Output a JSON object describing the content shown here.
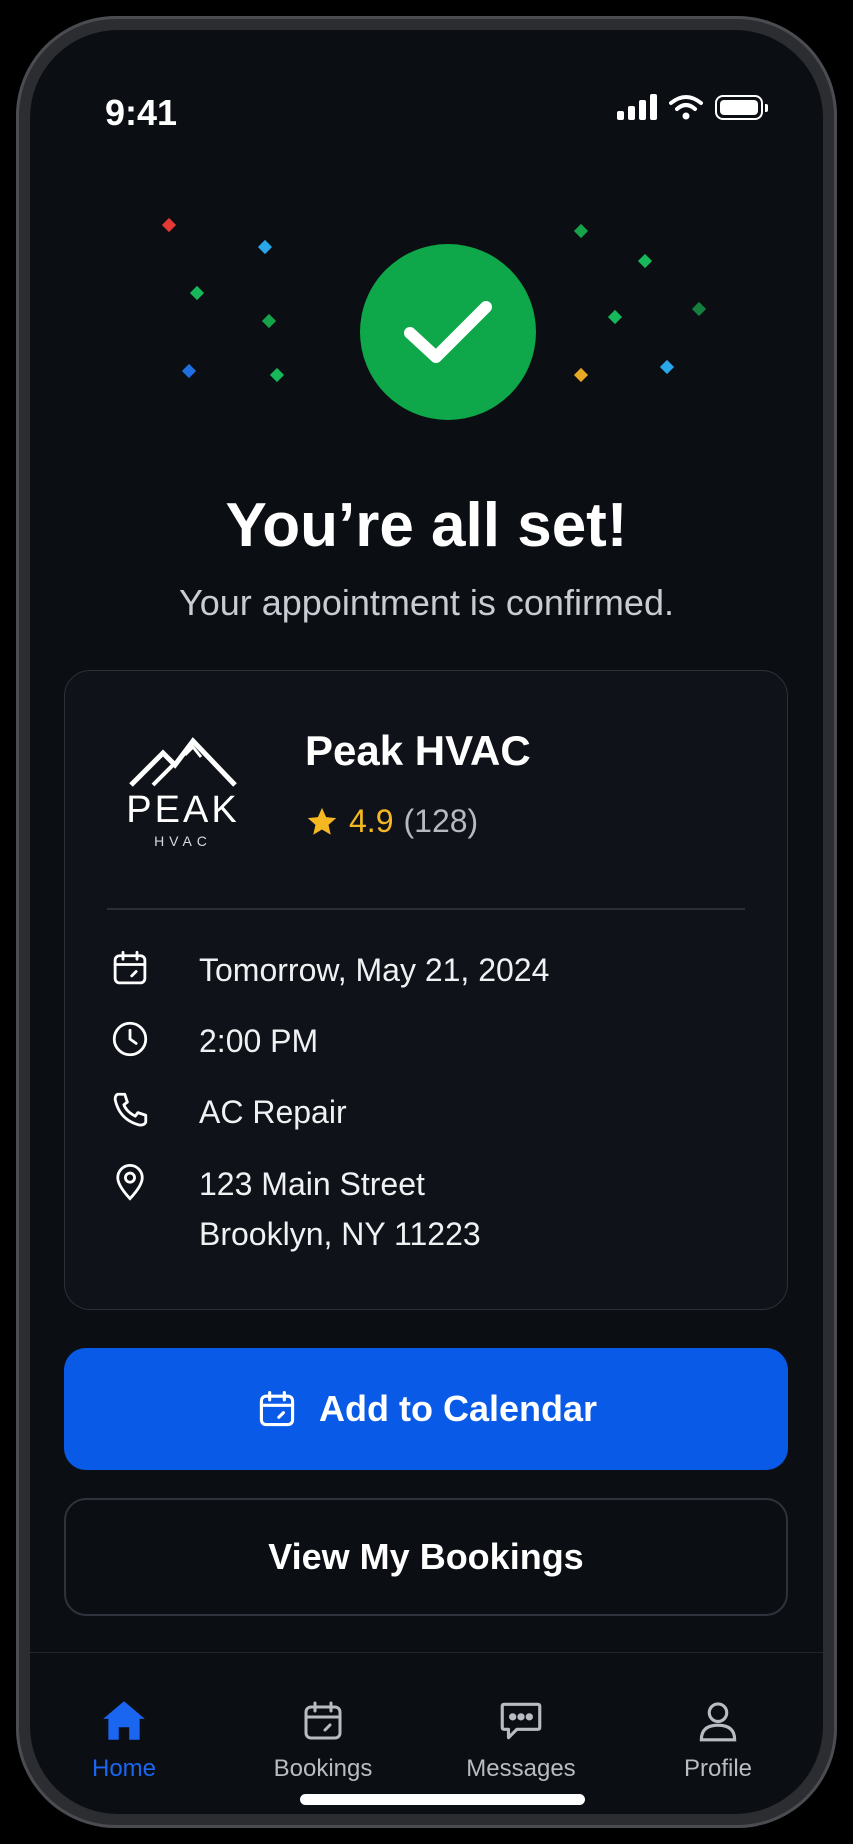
{
  "status_bar": {
    "time": "9:41"
  },
  "hero": {
    "title": "You’re all set!",
    "subtitle": "Your appointment is confirmed.",
    "accent_color": "#0ea84a"
  },
  "business": {
    "logo_text": "PEAK",
    "logo_subtext": "HVAC",
    "name": "Peak HVAC",
    "rating": "4.9",
    "review_count": "(128)"
  },
  "details": {
    "date": "Tomorrow, May 21, 2024",
    "time": "2:00 PM",
    "service": "AC Repair",
    "address_line1": "123 Main Street",
    "address_line2": "Brooklyn, NY 11223"
  },
  "actions": {
    "add_calendar": "Add to Calendar",
    "view_bookings": "View My Bookings",
    "primary_color": "#0a5ae8"
  },
  "tabs": [
    {
      "label": "Home",
      "icon": "home-icon",
      "active": true
    },
    {
      "label": "Bookings",
      "icon": "calendar-icon",
      "active": false
    },
    {
      "label": "Messages",
      "icon": "chat-icon",
      "active": false
    },
    {
      "label": "Profile",
      "icon": "person-icon",
      "active": false
    }
  ]
}
